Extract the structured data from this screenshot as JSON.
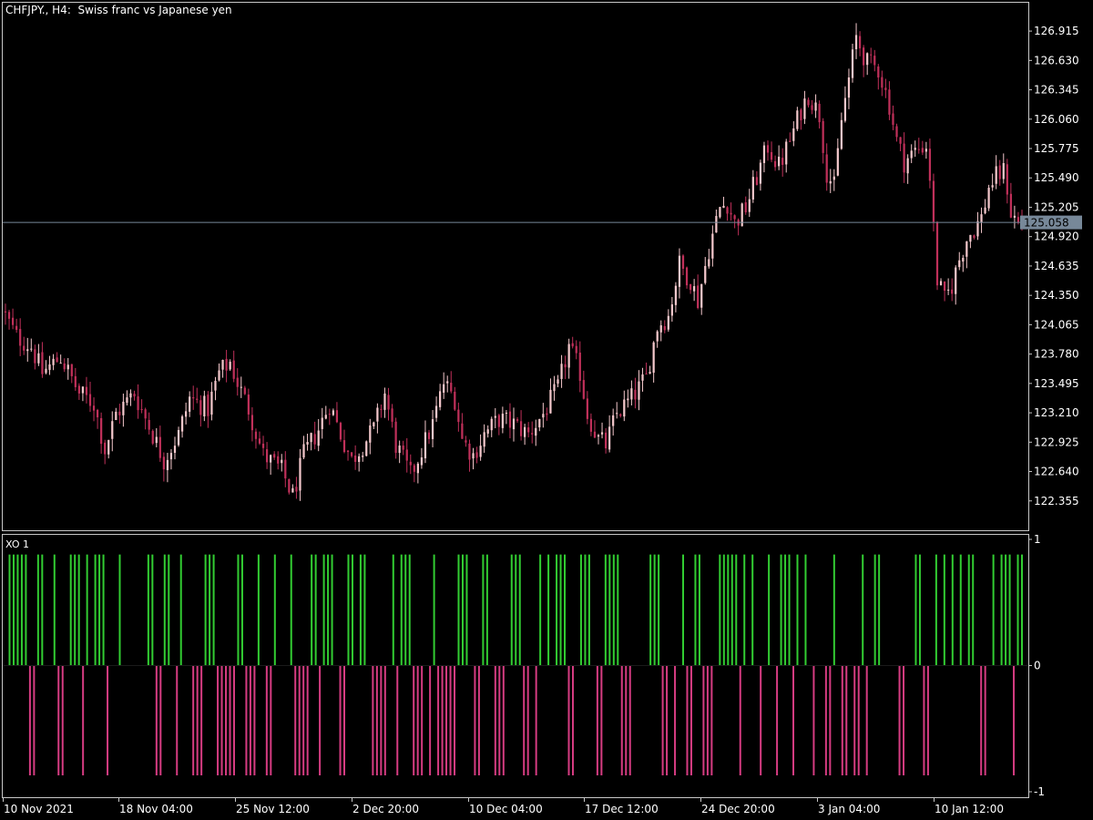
{
  "header": {
    "symbol": "CHFJPY.",
    "timeframe": "H4",
    "description": "Swiss franc vs Japanese yen",
    "title": "CHFJPY., H4:  Swiss franc vs Japanese yen"
  },
  "indicator": {
    "title": "XO 1"
  },
  "colors": {
    "background": "#000000",
    "frame": "#c8c8c8",
    "text": "#ffffff",
    "bull_candle": "#f4c8cc",
    "bear_candle": "#c0305a",
    "hist_positive": "#32cd32",
    "hist_negative": "#d63c82",
    "current_price_line": "#778899",
    "current_price_label_bg": "#778899"
  },
  "chart_data": [
    {
      "type": "candlestick",
      "title": "CHFJPY., H4:  Swiss franc vs Japanese yen",
      "ylim": [
        122.07,
        127.19
      ],
      "y_ticks": [
        "126.915",
        "126.630",
        "126.345",
        "126.060",
        "125.775",
        "125.490",
        "125.205",
        "124.920",
        "124.635",
        "124.350",
        "124.065",
        "123.780",
        "123.495",
        "123.210",
        "122.925",
        "122.640",
        "122.355"
      ],
      "current_price": "125.058",
      "x_ticks": [
        "10 Nov 2021",
        "18 Nov 04:00",
        "25 Nov 12:00",
        "2 Dec 20:00",
        "10 Dec 04:00",
        "17 Dec 12:00",
        "24 Dec 20:00",
        "3 Jan 04:00",
        "10 Jan 12:00"
      ],
      "closes_anchor": [
        [
          0,
          124.15
        ],
        [
          3,
          123.95
        ],
        [
          7,
          123.85
        ],
        [
          10,
          123.6
        ],
        [
          15,
          123.75
        ],
        [
          20,
          123.4
        ],
        [
          24,
          123.3
        ],
        [
          27,
          122.85
        ],
        [
          30,
          123.2
        ],
        [
          35,
          123.4
        ],
        [
          40,
          123.0
        ],
        [
          43,
          122.75
        ],
        [
          47,
          123.0
        ],
        [
          50,
          123.35
        ],
        [
          55,
          123.25
        ],
        [
          58,
          123.6
        ],
        [
          61,
          123.7
        ],
        [
          63,
          123.5
        ],
        [
          66,
          123.25
        ],
        [
          70,
          122.8
        ],
        [
          75,
          122.65
        ],
        [
          78,
          122.4
        ],
        [
          81,
          122.8
        ],
        [
          85,
          123.05
        ],
        [
          88,
          123.3
        ],
        [
          91,
          123.0
        ],
        [
          94,
          122.75
        ],
        [
          97,
          122.9
        ],
        [
          100,
          123.05
        ],
        [
          103,
          123.4
        ],
        [
          106,
          122.9
        ],
        [
          110,
          122.6
        ],
        [
          113,
          122.85
        ],
        [
          116,
          123.1
        ],
        [
          119,
          123.5
        ],
        [
          122,
          123.35
        ],
        [
          124,
          122.95
        ],
        [
          127,
          122.8
        ],
        [
          130,
          123.0
        ],
        [
          134,
          123.15
        ],
        [
          138,
          123.1
        ],
        [
          142,
          123.0
        ],
        [
          146,
          123.2
        ],
        [
          150,
          123.45
        ],
        [
          153,
          123.85
        ],
        [
          156,
          123.6
        ],
        [
          158,
          123.2
        ],
        [
          161,
          122.95
        ],
        [
          163,
          122.9
        ],
        [
          166,
          123.2
        ],
        [
          170,
          123.35
        ],
        [
          174,
          123.55
        ],
        [
          177,
          124.05
        ],
        [
          180,
          124.15
        ],
        [
          183,
          124.65
        ],
        [
          186,
          124.5
        ],
        [
          188,
          124.3
        ],
        [
          191,
          124.8
        ],
        [
          194,
          125.2
        ],
        [
          196,
          125.25
        ],
        [
          198,
          125.05
        ],
        [
          201,
          125.2
        ],
        [
          204,
          125.5
        ],
        [
          207,
          125.8
        ],
        [
          210,
          125.6
        ],
        [
          213,
          125.85
        ],
        [
          216,
          126.15
        ],
        [
          218,
          126.3
        ],
        [
          221,
          126.1
        ],
        [
          223,
          125.55
        ],
        [
          225,
          125.4
        ],
        [
          227,
          126.05
        ],
        [
          229,
          126.45
        ],
        [
          231,
          126.85
        ],
        [
          234,
          126.6
        ],
        [
          237,
          126.55
        ],
        [
          240,
          126.2
        ],
        [
          242,
          125.85
        ],
        [
          244,
          125.65
        ],
        [
          247,
          125.75
        ],
        [
          249,
          125.8
        ],
        [
          250,
          125.8
        ],
        [
          251,
          125.5
        ],
        [
          253,
          124.5
        ],
        [
          255,
          124.3
        ],
        [
          257,
          124.45
        ],
        [
          259,
          124.7
        ],
        [
          261,
          124.9
        ],
        [
          263,
          125.0
        ],
        [
          265,
          125.1
        ],
        [
          267,
          125.4
        ],
        [
          269,
          125.5
        ],
        [
          271,
          125.55
        ],
        [
          272,
          125.4
        ],
        [
          273,
          125.15
        ],
        [
          275,
          125.05
        ],
        [
          276,
          125.06
        ]
      ]
    },
    {
      "type": "bar",
      "title": "XO 1",
      "ylim": [
        -1,
        1
      ],
      "y_ticks": [
        "1",
        "0",
        "-1"
      ],
      "positive_value": 0.88,
      "negative_value": -0.87
    }
  ]
}
